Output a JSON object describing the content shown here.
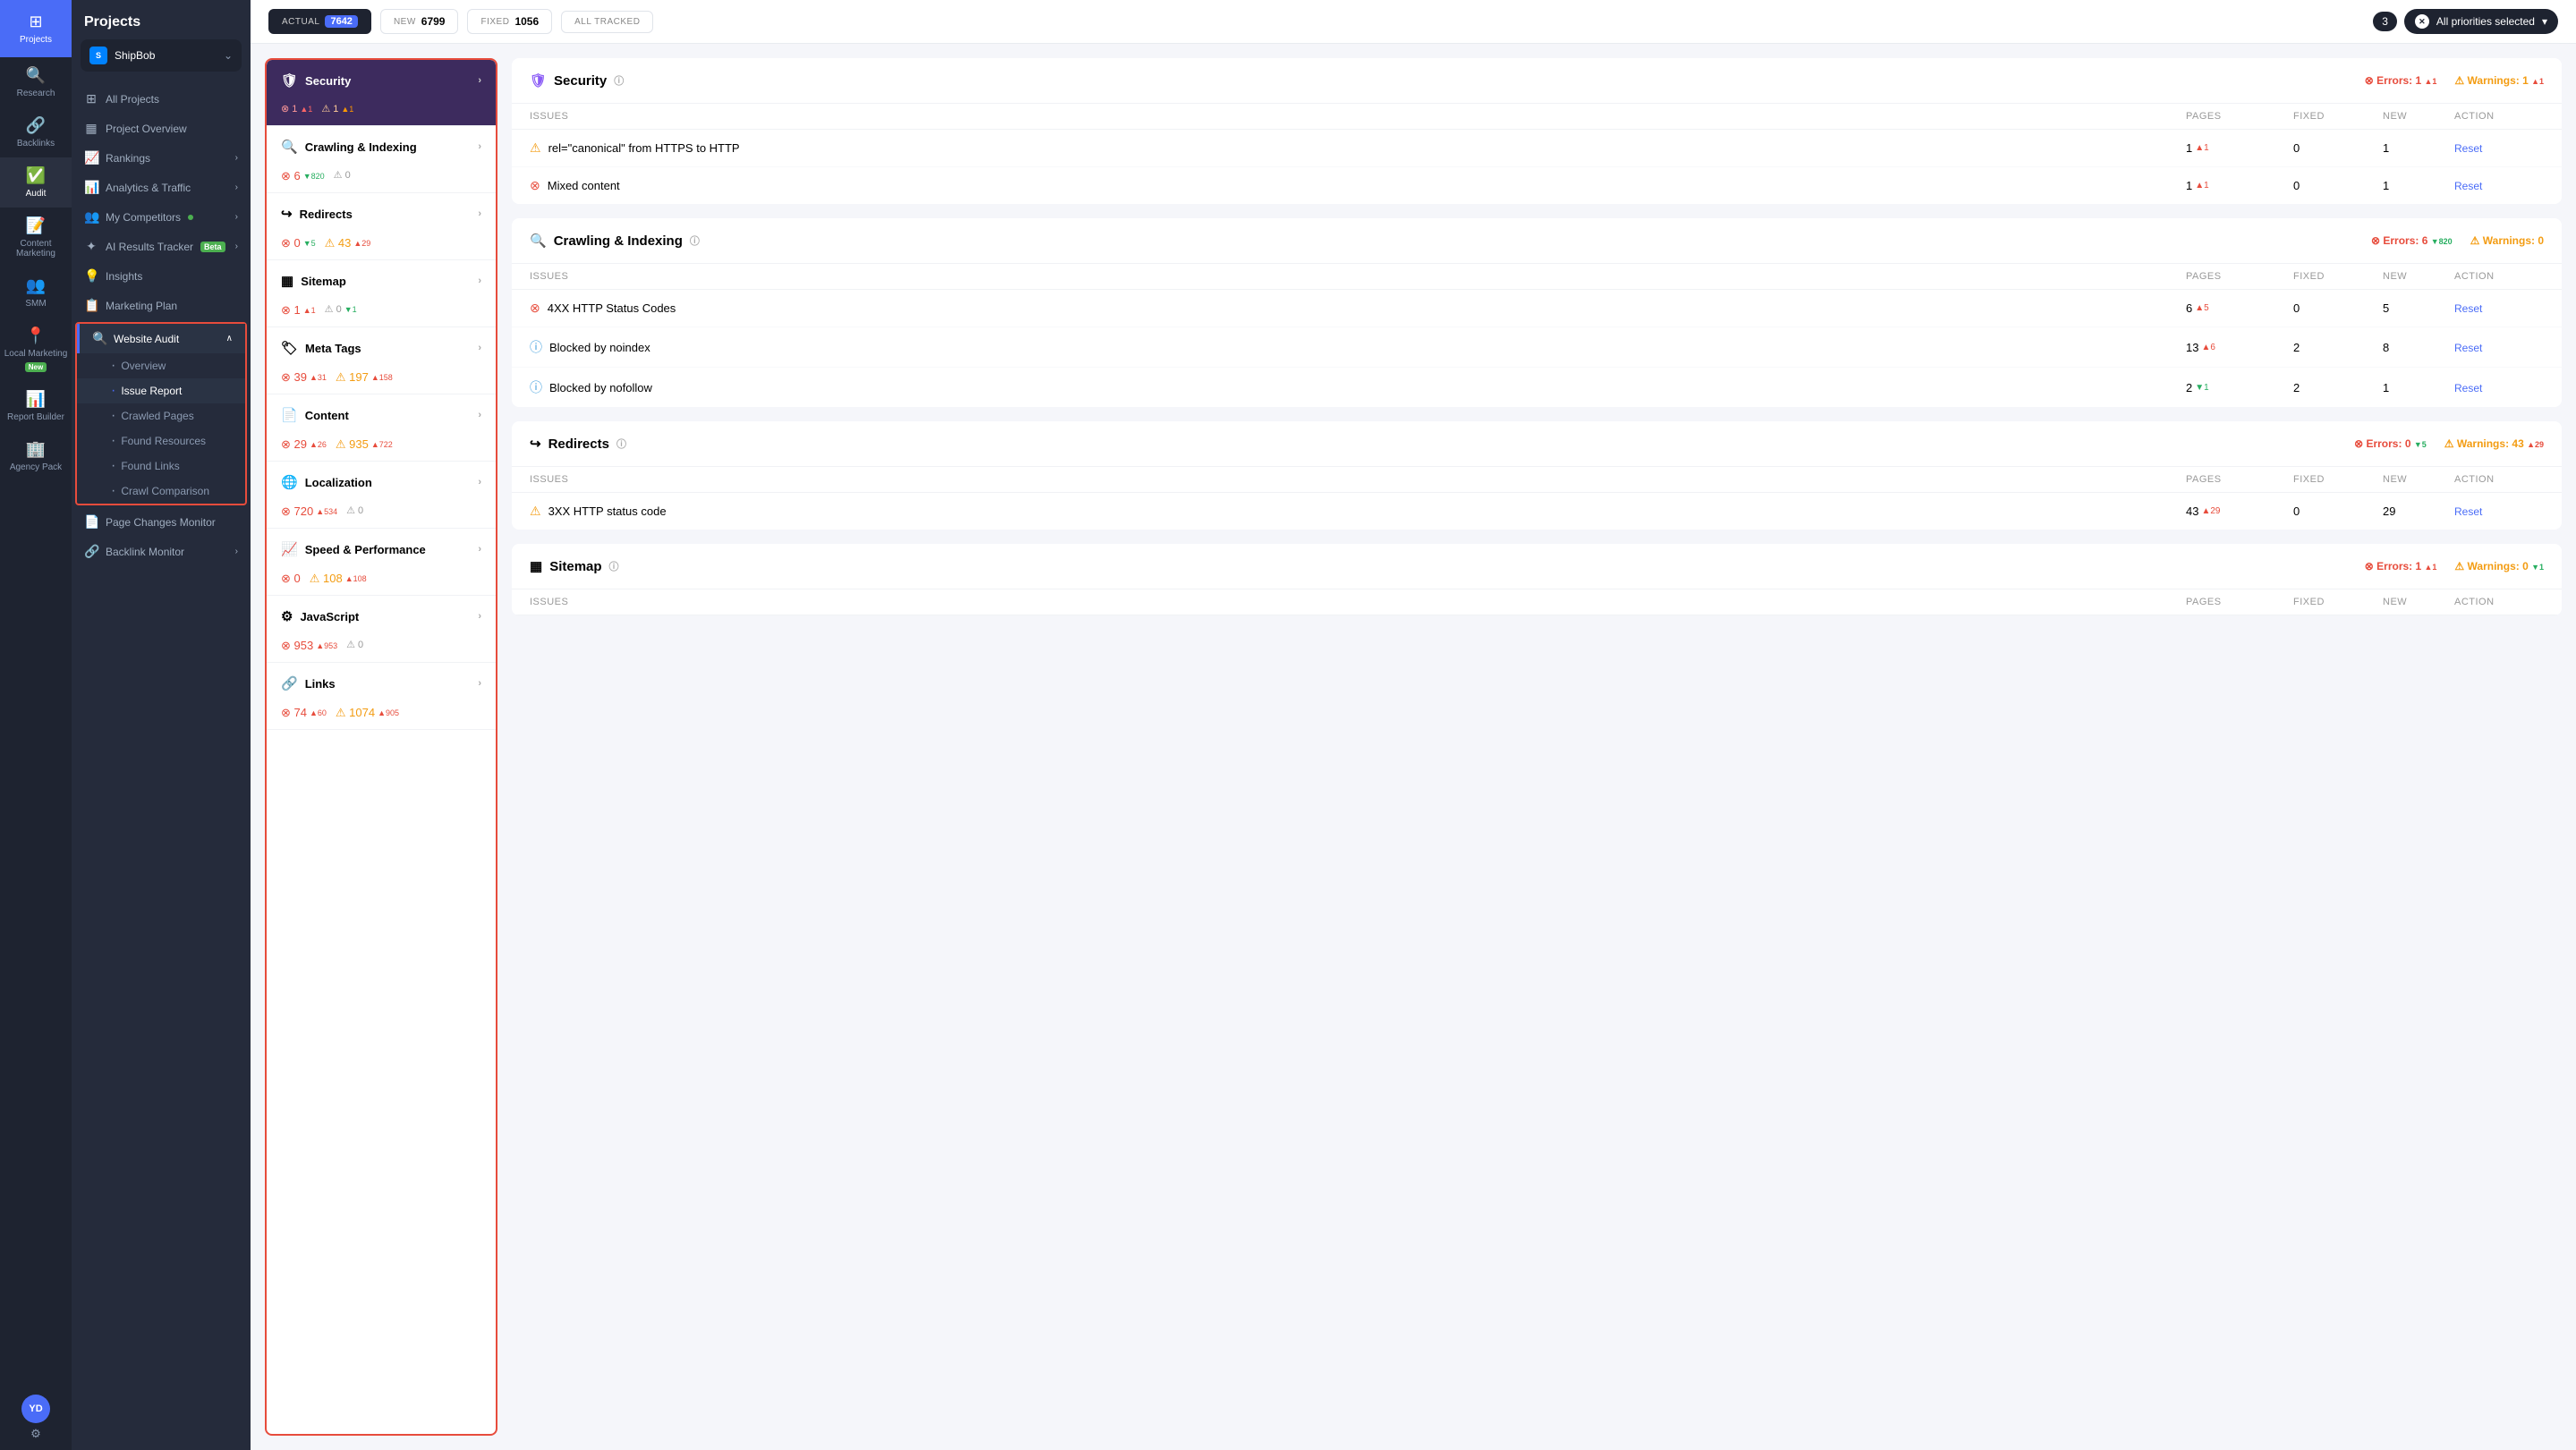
{
  "sidebar": {
    "items": [
      {
        "id": "projects",
        "label": "Projects",
        "icon": "⊞",
        "active": true
      },
      {
        "id": "research",
        "label": "Research",
        "icon": "🔍"
      },
      {
        "id": "backlinks",
        "label": "Backlinks",
        "icon": "🔗"
      },
      {
        "id": "audit",
        "label": "Audit",
        "icon": "✅"
      },
      {
        "id": "content-marketing",
        "label": "Content Marketing",
        "icon": "📝"
      },
      {
        "id": "smm",
        "label": "SMM",
        "icon": "👥"
      },
      {
        "id": "local-marketing",
        "label": "Local Marketing",
        "icon": "📍",
        "badge": "New"
      },
      {
        "id": "report-builder",
        "label": "Report Builder",
        "icon": "📊"
      },
      {
        "id": "agency-pack",
        "label": "Agency Pack",
        "icon": "🏢"
      }
    ],
    "avatar": {
      "initials": "YD",
      "settings_icon": "⚙"
    }
  },
  "nav_panel": {
    "title": "Projects",
    "project": {
      "name": "ShipBob",
      "logo": "S"
    },
    "items": [
      {
        "id": "all-projects",
        "label": "All Projects",
        "icon": "⊞"
      },
      {
        "id": "project-overview",
        "label": "Project Overview",
        "icon": "▦"
      },
      {
        "id": "rankings",
        "label": "Rankings",
        "icon": "📈",
        "has_chevron": true
      },
      {
        "id": "analytics-traffic",
        "label": "Analytics & Traffic",
        "icon": "📊",
        "has_chevron": true
      },
      {
        "id": "my-competitors",
        "label": "My Competitors",
        "icon": "👥",
        "dot": true,
        "has_chevron": true
      },
      {
        "id": "ai-results-tracker",
        "label": "AI Results Tracker",
        "icon": "✦",
        "badge": "Beta",
        "has_chevron": true
      },
      {
        "id": "insights",
        "label": "Insights",
        "icon": "💡"
      },
      {
        "id": "marketing-plan",
        "label": "Marketing Plan",
        "icon": "📋"
      },
      {
        "id": "website-audit",
        "label": "Website Audit",
        "icon": "🔍",
        "active": true,
        "has_chevron": true,
        "expanded": true
      },
      {
        "id": "page-changes-monitor",
        "label": "Page Changes Monitor",
        "icon": "📄"
      },
      {
        "id": "backlink-monitor",
        "label": "Backlink Monitor",
        "icon": "🔗",
        "has_chevron": true
      }
    ],
    "sub_items": [
      {
        "id": "overview",
        "label": "Overview"
      },
      {
        "id": "issue-report",
        "label": "Issue Report",
        "active": true
      },
      {
        "id": "crawled-pages",
        "label": "Crawled Pages"
      },
      {
        "id": "found-resources",
        "label": "Found Resources"
      },
      {
        "id": "found-links",
        "label": "Found Links"
      },
      {
        "id": "crawl-comparison",
        "label": "Crawl Comparison"
      }
    ]
  },
  "topbar": {
    "stats": [
      {
        "id": "actual",
        "label": "ACTUAL",
        "value": "7642",
        "active": true
      },
      {
        "id": "new",
        "label": "NEW",
        "value": "6799"
      },
      {
        "id": "fixed",
        "label": "FIXED",
        "value": "1056"
      },
      {
        "id": "all-tracked",
        "label": "ALL TRACKED",
        "value": ""
      }
    ],
    "priority_filter": {
      "count": "3",
      "label": "All priorities selected",
      "chevron": "▾"
    }
  },
  "issue_list": {
    "categories": [
      {
        "id": "security",
        "label": "Security",
        "icon": "🛡",
        "errors": "1",
        "errors_trend": "▲1",
        "warnings": "1",
        "warnings_trend": "▲1",
        "is_selected": true
      },
      {
        "id": "crawling-indexing",
        "label": "Crawling & Indexing",
        "icon": "🔍",
        "errors": "6",
        "errors_trend": "▼820",
        "warnings": "0",
        "warnings_trend": ""
      },
      {
        "id": "redirects",
        "label": "Redirects",
        "icon": "↪",
        "errors": "0",
        "errors_trend": "▼5",
        "warnings": "43",
        "warnings_trend": "▲29"
      },
      {
        "id": "sitemap",
        "label": "Sitemap",
        "icon": "▦",
        "errors": "1",
        "errors_trend": "▲1",
        "warnings": "0",
        "warnings_trend": "▼1"
      },
      {
        "id": "meta-tags",
        "label": "Meta Tags",
        "icon": "🏷",
        "errors": "39",
        "errors_trend": "▲31",
        "warnings": "197",
        "warnings_trend": "▲158"
      },
      {
        "id": "content",
        "label": "Content",
        "icon": "📄",
        "errors": "29",
        "errors_trend": "▲26",
        "warnings": "935",
        "warnings_trend": "▲722"
      },
      {
        "id": "localization",
        "label": "Localization",
        "icon": "🌐",
        "errors": "720",
        "errors_trend": "▲534",
        "warnings": "0",
        "warnings_trend": ""
      },
      {
        "id": "speed-performance",
        "label": "Speed & Performance",
        "icon": "📈",
        "errors": "0",
        "errors_trend": "",
        "warnings": "108",
        "warnings_trend": "▲108"
      },
      {
        "id": "javascript",
        "label": "JavaScript",
        "icon": "⚙",
        "errors": "953",
        "errors_trend": "▲953",
        "warnings": "0",
        "warnings_trend": ""
      },
      {
        "id": "links",
        "label": "Links",
        "icon": "🔗",
        "errors": "74",
        "errors_trend": "▲60",
        "warnings": "1074",
        "warnings_trend": "▲905"
      }
    ]
  },
  "issue_detail": {
    "sections": [
      {
        "id": "security",
        "label": "Security",
        "icon": "🛡",
        "icon_class": "sec-icon",
        "errors_label": "Errors: 1",
        "errors_trend": "▲1",
        "warnings_label": "Warnings: 1",
        "warnings_trend": "▲1",
        "col_headers": [
          "ISSUES",
          "PAGES",
          "FIXED",
          "NEW",
          "ACTION"
        ],
        "rows": [
          {
            "icon": "warn",
            "issue": "rel=\"canonical\" from HTTPS to HTTP",
            "pages": "1",
            "pages_trend": "▲1",
            "fixed": "0",
            "new_val": "1",
            "action": "Reset"
          },
          {
            "icon": "error",
            "issue": "Mixed content",
            "pages": "1",
            "pages_trend": "▲1",
            "fixed": "0",
            "new_val": "1",
            "action": "Reset"
          }
        ]
      },
      {
        "id": "crawling-indexing",
        "label": "Crawling & Indexing",
        "icon": "🔍",
        "errors_label": "Errors: 6",
        "errors_trend": "▼820",
        "warnings_label": "Warnings: 0",
        "warnings_trend": "",
        "col_headers": [
          "ISSUES",
          "PAGES",
          "FIXED",
          "NEW",
          "ACTION"
        ],
        "rows": [
          {
            "icon": "error",
            "issue": "4XX HTTP Status Codes",
            "pages": "6",
            "pages_trend": "▲5",
            "fixed": "0",
            "new_val": "5",
            "action": "Reset"
          },
          {
            "icon": "info",
            "issue": "Blocked by noindex",
            "pages": "13",
            "pages_trend": "▲6",
            "fixed": "2",
            "new_val": "8",
            "action": "Reset"
          },
          {
            "icon": "info",
            "issue": "Blocked by nofollow",
            "pages": "2",
            "pages_trend": "▼1",
            "fixed": "2",
            "new_val": "1",
            "action": "Reset"
          }
        ]
      },
      {
        "id": "redirects",
        "label": "Redirects",
        "icon": "↪",
        "errors_label": "Errors: 0",
        "errors_trend": "▼5",
        "warnings_label": "Warnings: 43",
        "warnings_trend": "▲29",
        "col_headers": [
          "ISSUES",
          "PAGES",
          "FIXED",
          "NEW",
          "ACTION"
        ],
        "rows": [
          {
            "icon": "warn",
            "issue": "3XX HTTP status code",
            "pages": "43",
            "pages_trend": "▲29",
            "fixed": "0",
            "new_val": "29",
            "action": "Reset"
          }
        ]
      },
      {
        "id": "sitemap",
        "label": "Sitemap",
        "icon": "▦",
        "errors_label": "Errors: 1",
        "errors_trend": "▲1",
        "warnings_label": "Warnings: 0",
        "warnings_trend": "▼1",
        "col_headers": [
          "ISSUES",
          "PAGES",
          "FIXED",
          "NEW",
          "ACTION"
        ],
        "rows": []
      }
    ]
  }
}
